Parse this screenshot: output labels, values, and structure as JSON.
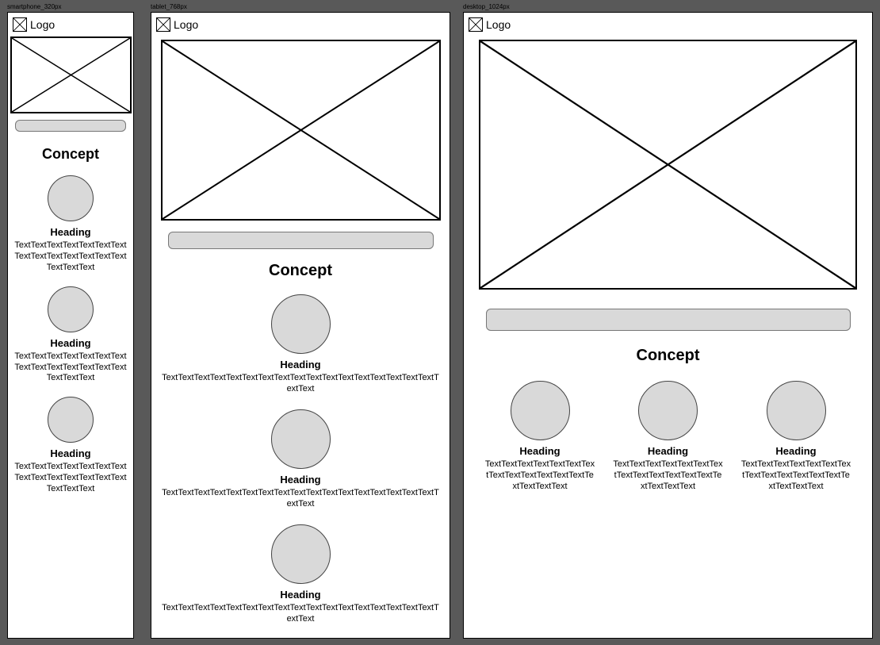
{
  "labels": {
    "sm": "smartphone_320px",
    "md": "tablet_768px",
    "lg": "desktop_1024px"
  },
  "logo": "Logo",
  "concept": "Concept",
  "item": {
    "heading": "Heading",
    "body_short": "TextTextTextTextTextTextTextTextTextTextTextTextTextTextTextTextText",
    "body_long": "TextTextTextTextTextTextTextTextTextTextTextTextTextTextTextTextTextTextText"
  }
}
